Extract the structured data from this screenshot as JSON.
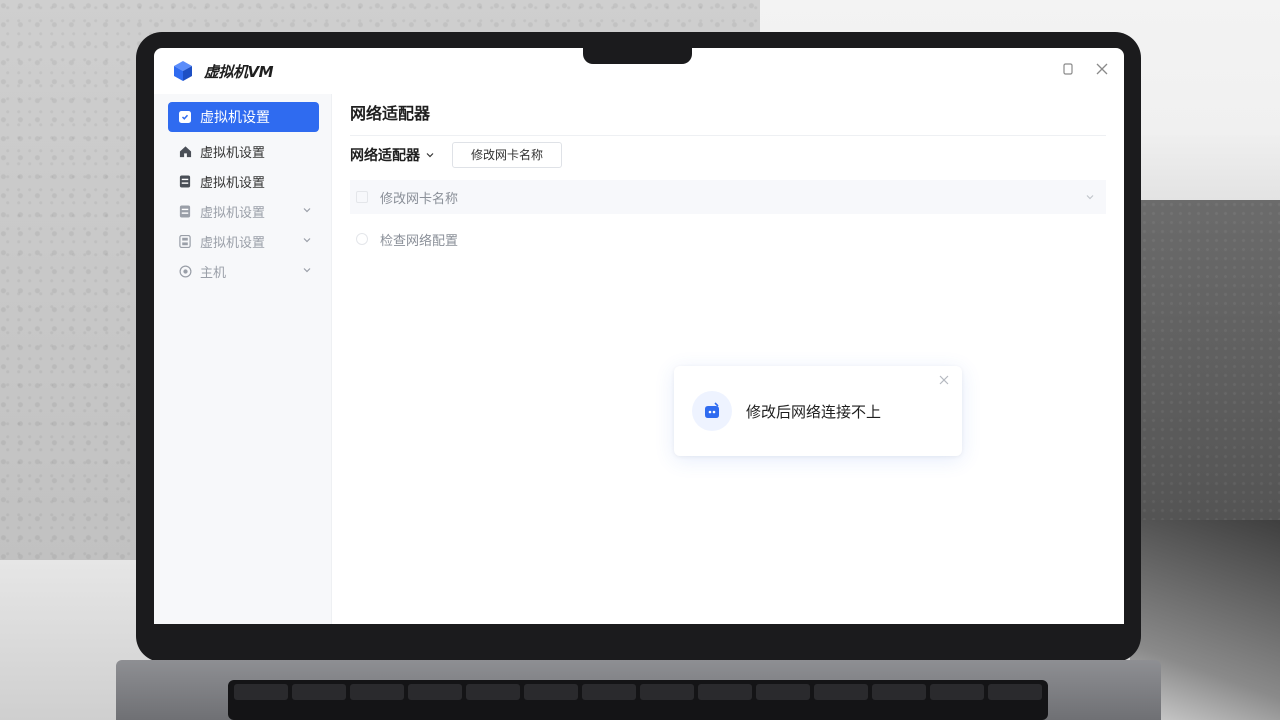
{
  "app": {
    "title": "虚拟机VM",
    "accent_color": "#2f6bf0"
  },
  "window_controls": {
    "restore_icon": "restore-icon",
    "close_icon": "close-icon"
  },
  "sidebar": {
    "items": [
      {
        "label": "虚拟机设置",
        "icon": "vm-settings-icon",
        "active": true
      },
      {
        "label": "虚拟机设置",
        "icon": "home-icon"
      },
      {
        "label": "虚拟机设置",
        "icon": "server-icon"
      },
      {
        "label": "虚拟机设置",
        "icon": "server-icon",
        "expandable": true
      },
      {
        "label": "虚拟机设置",
        "icon": "disk-icon",
        "expandable": true
      },
      {
        "label": "主机",
        "icon": "target-icon",
        "expandable": true
      }
    ]
  },
  "main": {
    "page_title": "网络适配器",
    "dropdown_label": "网络适配器",
    "rename_button": "修改网卡名称",
    "rows": [
      {
        "label": "修改网卡名称"
      },
      {
        "label": "检查网络配置"
      }
    ]
  },
  "toast": {
    "message": "修改后网络连接不上",
    "icon": "network-error-icon"
  }
}
